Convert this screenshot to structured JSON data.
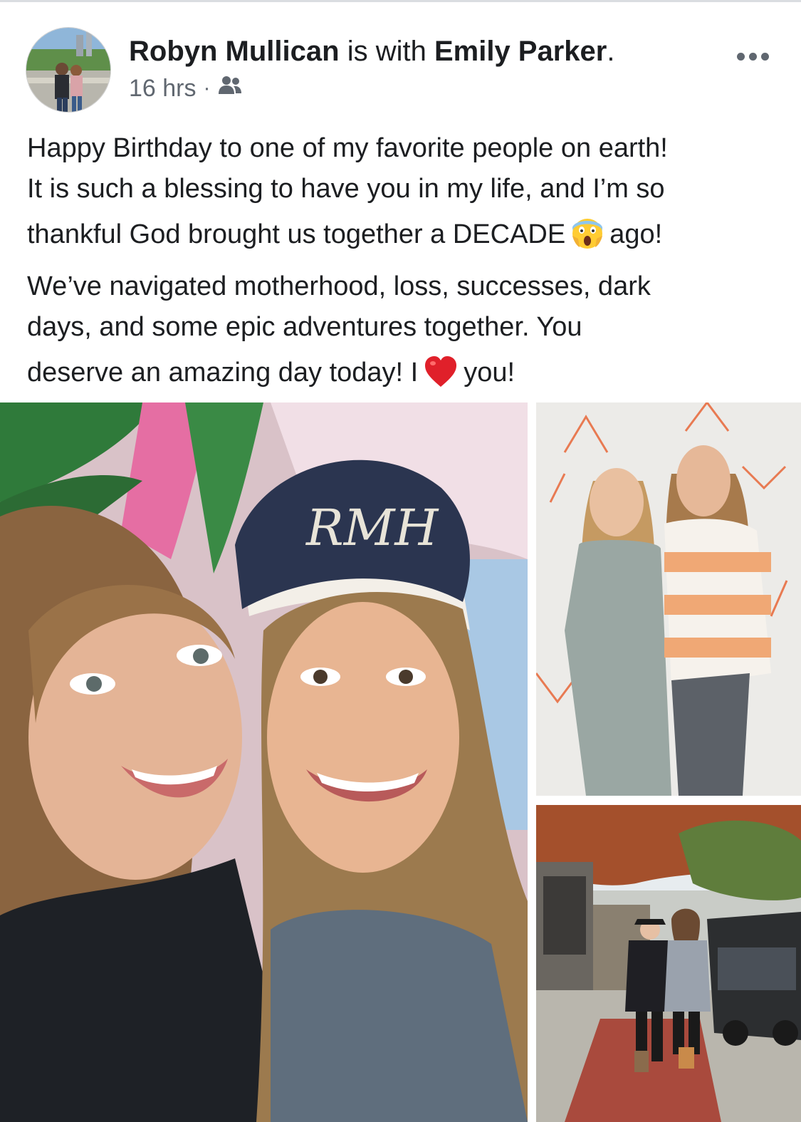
{
  "post": {
    "author": "Robyn Mullican",
    "with_label": "is with",
    "tagged_person": "Emily Parker",
    "name_period": ".",
    "timestamp": "16 hrs",
    "audience_icon": "friends-audience-icon",
    "more_icon": "more-horizontal-icon",
    "text_lines": {
      "line1": "Happy Birthday to one of my favorite people on earth!",
      "line2": "It is such a blessing to have you in my life, and I’m so",
      "line3a": "thankful God brought us together a DECADE",
      "line3b": "ago!",
      "line4": "We’ve navigated motherhood, loss, successes, dark",
      "line5": "days, and some epic adventures together. You",
      "line6a": "deserve an amazing day today!  I",
      "line6b": "you!"
    },
    "emoji_1": "scream-emoji",
    "emoji_2": "red-heart-emoji"
  },
  "photos": {
    "main_cap_monogram": "RMH"
  },
  "colors": {
    "secondary_text": "#606770",
    "primary_text": "#1c1e21"
  }
}
